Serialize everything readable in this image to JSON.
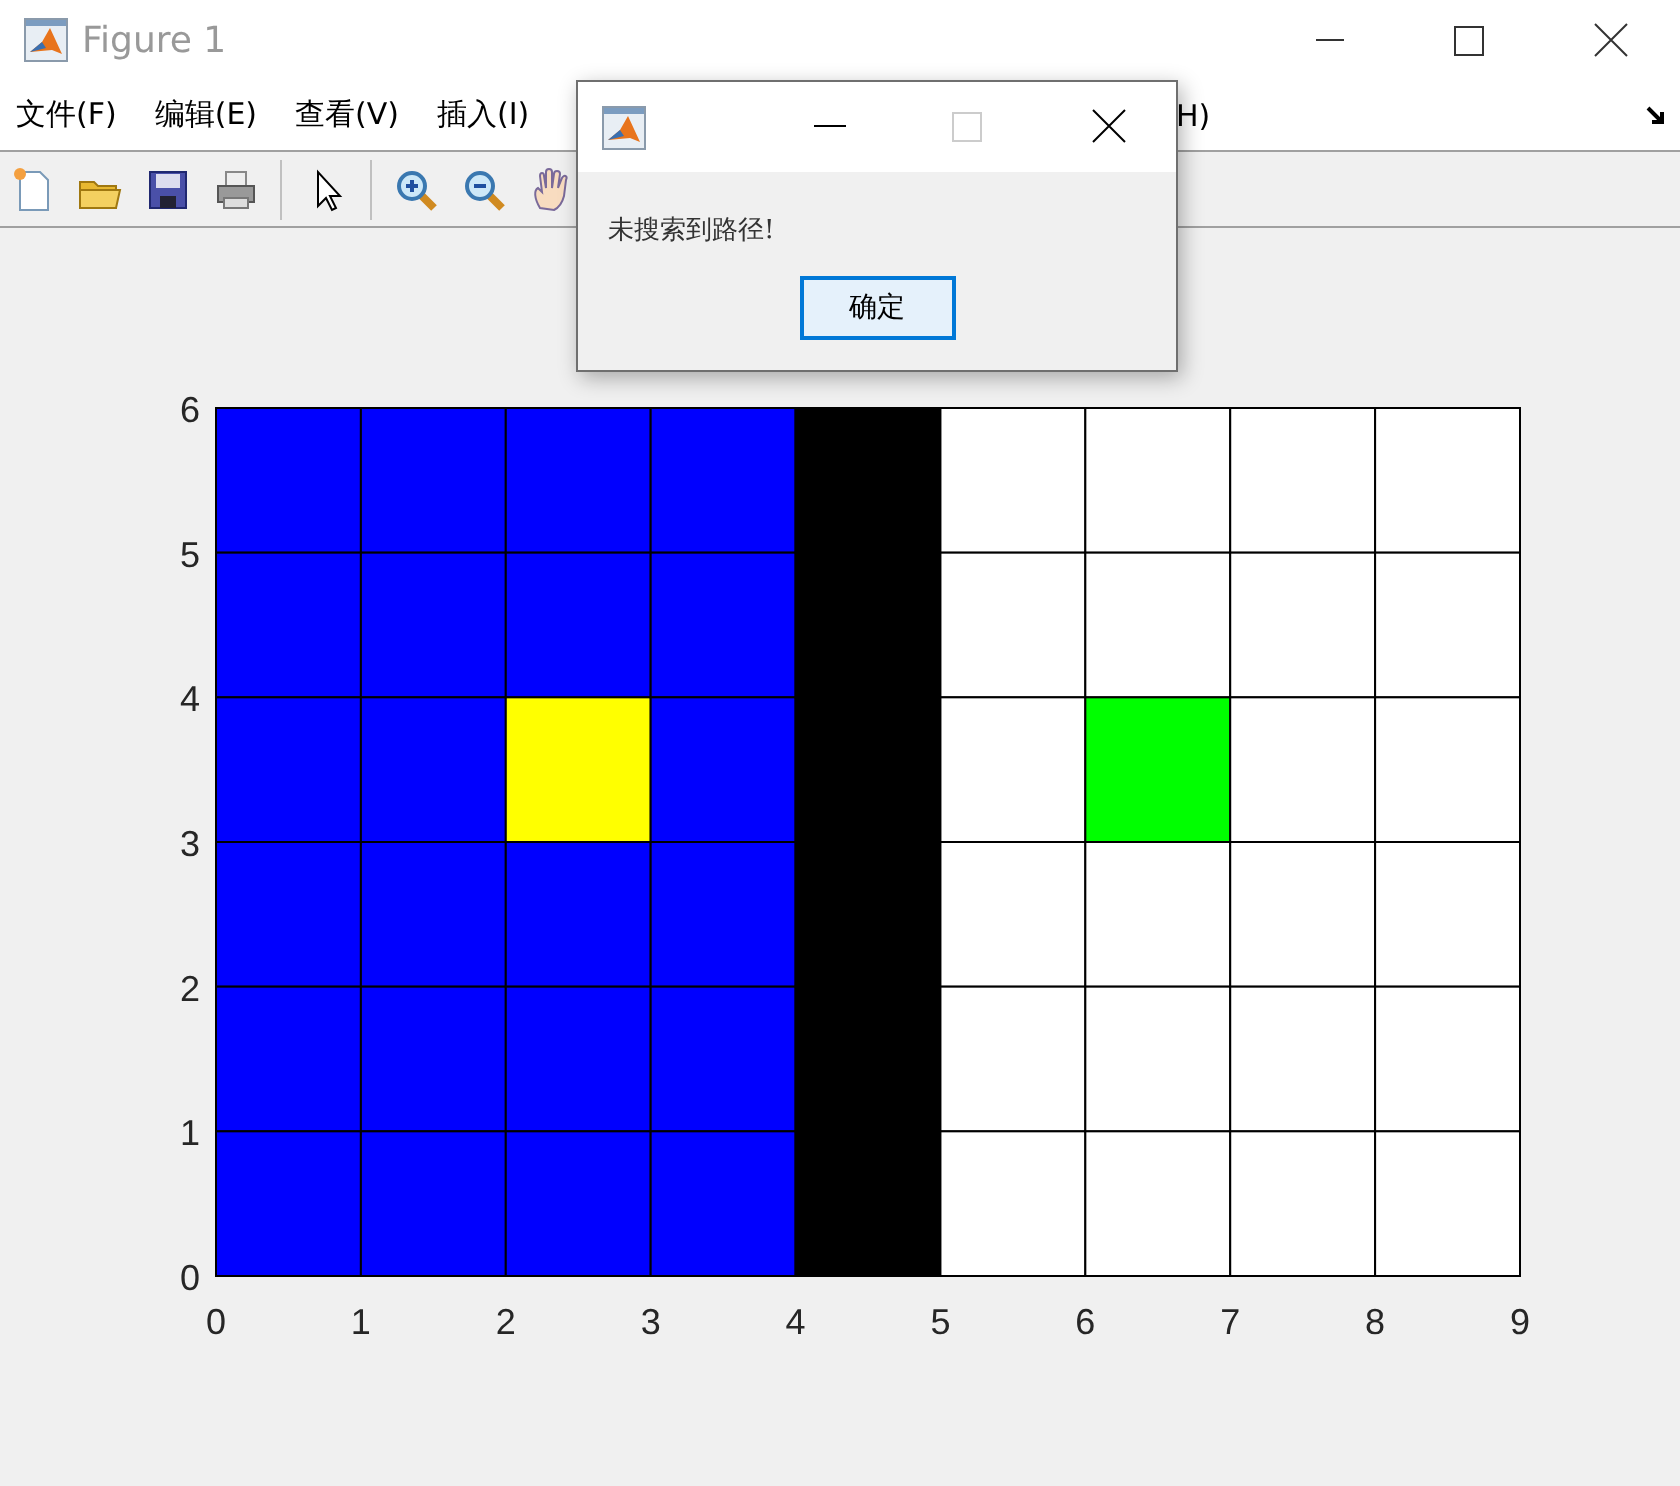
{
  "window": {
    "title": "Figure 1"
  },
  "menu": {
    "items": [
      "文件(F)",
      "编辑(E)",
      "查看(V)",
      "插入(I)"
    ],
    "partial_item": "H)"
  },
  "toolbar": {
    "tools": [
      {
        "kind": "new"
      },
      {
        "kind": "open"
      },
      {
        "kind": "save"
      },
      {
        "kind": "print"
      },
      {
        "kind": "separator"
      },
      {
        "kind": "pointer"
      },
      {
        "kind": "separator"
      },
      {
        "kind": "zoom-in"
      },
      {
        "kind": "zoom-out"
      },
      {
        "kind": "pan"
      }
    ]
  },
  "plot": {
    "x_ticks": [
      "0",
      "1",
      "2",
      "3",
      "4",
      "5",
      "6",
      "7",
      "8",
      "9"
    ],
    "y_ticks": [
      "6",
      "5",
      "4",
      "3",
      "2",
      "1",
      "0"
    ],
    "columns": [
      {
        "cells": [
          {
            "color": "#0000ff"
          },
          {
            "color": "#0000ff"
          },
          {
            "color": "#0000ff"
          },
          {
            "color": "#0000ff"
          },
          {
            "color": "#0000ff"
          },
          {
            "color": "#0000ff"
          }
        ]
      },
      {
        "cells": [
          {
            "color": "#0000ff"
          },
          {
            "color": "#0000ff"
          },
          {
            "color": "#0000ff"
          },
          {
            "color": "#0000ff"
          },
          {
            "color": "#0000ff"
          },
          {
            "color": "#0000ff"
          }
        ]
      },
      {
        "cells": [
          {
            "color": "#0000ff"
          },
          {
            "color": "#0000ff"
          },
          {
            "color": "#ffff00"
          },
          {
            "color": "#0000ff"
          },
          {
            "color": "#0000ff"
          },
          {
            "color": "#0000ff"
          }
        ]
      },
      {
        "cells": [
          {
            "color": "#0000ff"
          },
          {
            "color": "#0000ff"
          },
          {
            "color": "#0000ff"
          },
          {
            "color": "#0000ff"
          },
          {
            "color": "#0000ff"
          },
          {
            "color": "#0000ff"
          }
        ]
      },
      {
        "cells": [
          {
            "color": "#000000"
          },
          {
            "color": "#000000"
          },
          {
            "color": "#000000"
          },
          {
            "color": "#000000"
          },
          {
            "color": "#000000"
          },
          {
            "color": "#000000"
          }
        ]
      },
      {
        "cells": [
          {
            "color": "#ffffff"
          },
          {
            "color": "#ffffff"
          },
          {
            "color": "#ffffff"
          },
          {
            "color": "#ffffff"
          },
          {
            "color": "#ffffff"
          },
          {
            "color": "#ffffff"
          }
        ]
      },
      {
        "cells": [
          {
            "color": "#ffffff"
          },
          {
            "color": "#ffffff"
          },
          {
            "color": "#00ff00"
          },
          {
            "color": "#ffffff"
          },
          {
            "color": "#ffffff"
          },
          {
            "color": "#ffffff"
          }
        ]
      },
      {
        "cells": [
          {
            "color": "#ffffff"
          },
          {
            "color": "#ffffff"
          },
          {
            "color": "#ffffff"
          },
          {
            "color": "#ffffff"
          },
          {
            "color": "#ffffff"
          },
          {
            "color": "#ffffff"
          }
        ]
      },
      {
        "cells": [
          {
            "color": "#ffffff"
          },
          {
            "color": "#ffffff"
          },
          {
            "color": "#ffffff"
          },
          {
            "color": "#ffffff"
          },
          {
            "color": "#ffffff"
          },
          {
            "color": "#ffffff"
          }
        ]
      }
    ]
  },
  "dialog": {
    "message": "未搜索到路径!",
    "button": "确定"
  }
}
